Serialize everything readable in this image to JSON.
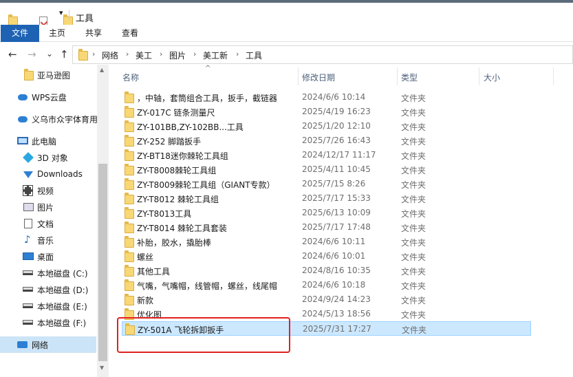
{
  "window": {
    "title": "工具"
  },
  "ribbon": {
    "tabs": [
      "文件",
      "主页",
      "共享",
      "查看"
    ]
  },
  "nav": {
    "back": "←",
    "forward": "→",
    "recent": "⌄",
    "up": "↑",
    "breadcrumb": [
      "网络",
      "美工",
      "图片",
      "美工新",
      "工具"
    ],
    "separator": "›"
  },
  "sidebar": {
    "items": [
      {
        "label": "亚马逊图",
        "icon": "folder-icon"
      },
      {
        "label": "WPS云盘",
        "icon": "cloud-icon"
      },
      {
        "label": "义乌市众宇体育用",
        "icon": "cloud-icon"
      },
      {
        "label": "此电脑",
        "icon": "computer-icon"
      },
      {
        "label": "3D 对象",
        "icon": "cube-icon"
      },
      {
        "label": "Downloads",
        "icon": "download-icon"
      },
      {
        "label": "视频",
        "icon": "video-icon"
      },
      {
        "label": "图片",
        "icon": "picture-icon"
      },
      {
        "label": "文档",
        "icon": "document-icon"
      },
      {
        "label": "音乐",
        "icon": "music-icon"
      },
      {
        "label": "桌面",
        "icon": "desktop-icon"
      },
      {
        "label": "本地磁盘 (C:)",
        "icon": "drive-icon"
      },
      {
        "label": "本地磁盘 (D:)",
        "icon": "drive-icon"
      },
      {
        "label": "本地磁盘 (E:)",
        "icon": "drive-icon"
      },
      {
        "label": "本地磁盘 (F:)",
        "icon": "drive-icon"
      },
      {
        "label": "网络",
        "icon": "network-icon"
      }
    ]
  },
  "columns": {
    "name": "名称",
    "date": "修改日期",
    "type": "类型",
    "size": "大小"
  },
  "files": [
    {
      "name": "，中轴，套筒组合工具，扳手，截链器",
      "date": "2024/6/6 10:14",
      "type": "文件夹"
    },
    {
      "name": "ZY-017C  链条测量尺",
      "date": "2025/4/19 16:23",
      "type": "文件夹"
    },
    {
      "name": "ZY-101BB,ZY-102BB...工具",
      "date": "2025/1/20 12:10",
      "type": "文件夹"
    },
    {
      "name": "ZY-252 脚踏扳手",
      "date": "2025/7/26 16:43",
      "type": "文件夹"
    },
    {
      "name": "ZY-BT18迷你棘轮工具组",
      "date": "2024/12/17 11:17",
      "type": "文件夹"
    },
    {
      "name": "ZY-T8008棘轮工具组",
      "date": "2025/4/11 10:45",
      "type": "文件夹"
    },
    {
      "name": "ZY-T8009棘轮工具组（GIANT专款）",
      "date": "2025/7/15 8:26",
      "type": "文件夹"
    },
    {
      "name": "ZY-T8012 棘轮工具组",
      "date": "2025/7/17 15:33",
      "type": "文件夹"
    },
    {
      "name": "ZY-T8013工具",
      "date": "2025/6/13 10:09",
      "type": "文件夹"
    },
    {
      "name": "ZY-T8014 棘轮工具套装",
      "date": "2025/7/17 17:48",
      "type": "文件夹"
    },
    {
      "name": "补胎，胶水，撬胎棒",
      "date": "2024/6/6 10:11",
      "type": "文件夹"
    },
    {
      "name": "螺丝",
      "date": "2024/6/6 10:01",
      "type": "文件夹"
    },
    {
      "name": "其他工具",
      "date": "2024/8/16 10:35",
      "type": "文件夹"
    },
    {
      "name": "气嘴，气嘴帽，线管帽，螺丝，线尾帽",
      "date": "2024/6/6 10:18",
      "type": "文件夹"
    },
    {
      "name": "新款",
      "date": "2024/9/24 14:23",
      "type": "文件夹"
    },
    {
      "name": "优化图",
      "date": "2024/5/13 18:56",
      "type": "文件夹"
    },
    {
      "name": "ZY-501A  飞轮拆卸扳手",
      "date": "2025/7/31 17:27",
      "type": "文件夹",
      "selected": true
    }
  ],
  "colors": {
    "accent": "#1e62b4",
    "selection": "#cce8ff",
    "highlight_box": "#e02020",
    "folder": "#f8d775"
  }
}
